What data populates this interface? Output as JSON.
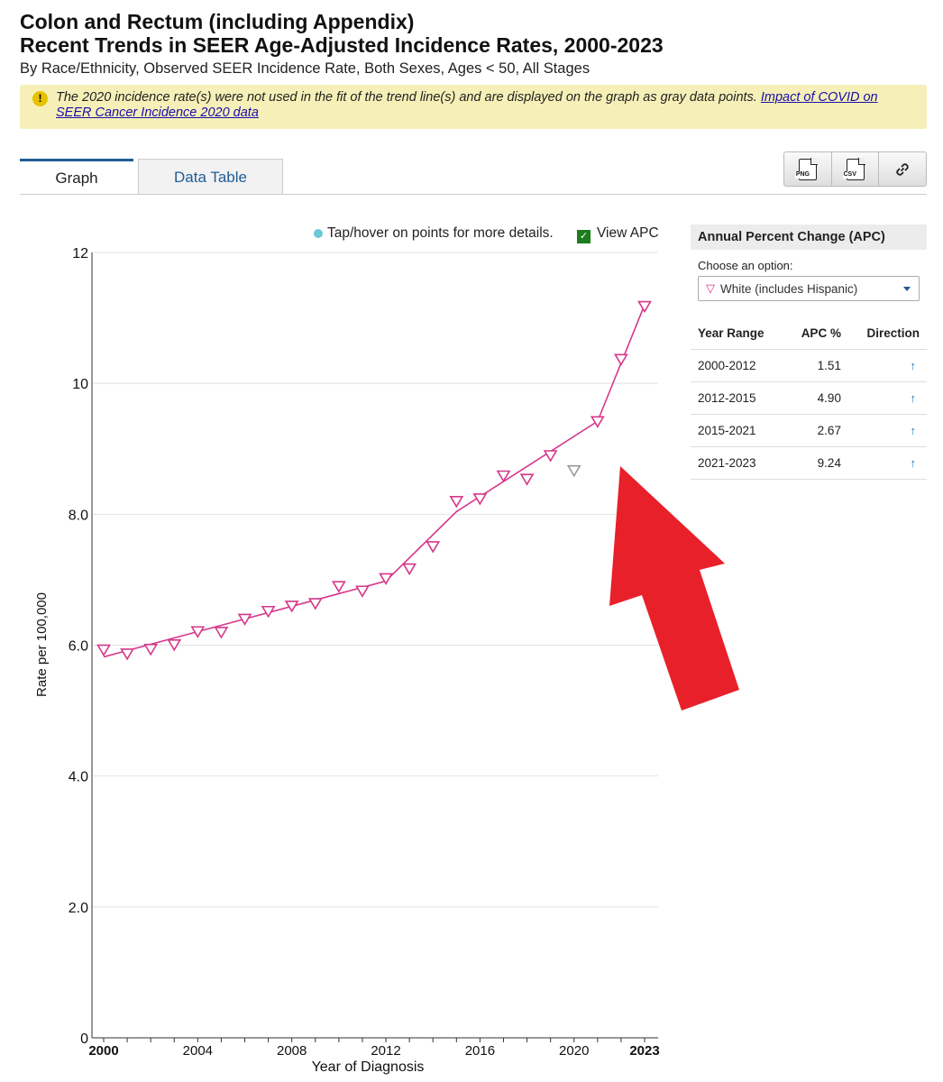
{
  "header": {
    "title_line1": "Colon and Rectum (including Appendix)",
    "title_line2": "Recent Trends in SEER Age-Adjusted Incidence Rates, 2000-2023",
    "subtitle": "By Race/Ethnicity, Observed SEER Incidence Rate, Both Sexes, Ages < 50, All Stages"
  },
  "notice": {
    "text": "The 2020 incidence rate(s) were not used in the fit of the trend line(s) and are displayed on the graph as gray data points. ",
    "link_text": "Impact of COVID on SEER Cancer Incidence 2020 data"
  },
  "tabs": {
    "graph": "Graph",
    "data_table": "Data Table"
  },
  "tools": {
    "png": "PNG",
    "csv": "CSV"
  },
  "hint": "Tap/hover on points for more details.",
  "apc_toggle_label": "View APC",
  "apc_panel": {
    "title": "Annual Percent Change (APC)",
    "choose_label": "Choose an option:",
    "selected": "White (includes Hispanic)",
    "columns": [
      "Year Range",
      "APC %",
      "Direction"
    ],
    "rows": [
      {
        "range": "2000-2012",
        "apc": "1.51",
        "direction": "↑"
      },
      {
        "range": "2012-2015",
        "apc": "4.90",
        "direction": "↑"
      },
      {
        "range": "2015-2021",
        "apc": "2.67",
        "direction": "↑"
      },
      {
        "range": "2021-2023",
        "apc": "9.24",
        "direction": "↑"
      }
    ]
  },
  "colors": {
    "series": "#d6378a",
    "excluded": "#999999",
    "annotation_arrow": "#e8202a"
  },
  "chart_data": {
    "type": "line",
    "xlabel": "Year of Diagnosis",
    "ylabel": "Rate per 100,000",
    "xlim": [
      2000,
      2023
    ],
    "ylim": [
      0,
      12
    ],
    "x_ticks": [
      {
        "value": 2000,
        "label": "2000",
        "bold": true
      },
      {
        "value": 2004,
        "label": "2004"
      },
      {
        "value": 2008,
        "label": "2008"
      },
      {
        "value": 2012,
        "label": "2012"
      },
      {
        "value": 2016,
        "label": "2016"
      },
      {
        "value": 2020,
        "label": "2020"
      },
      {
        "value": 2023,
        "label": "2023",
        "bold": true
      }
    ],
    "y_ticks": [
      {
        "value": 0,
        "label": "0"
      },
      {
        "value": 2,
        "label": "2.0"
      },
      {
        "value": 4,
        "label": "4.0"
      },
      {
        "value": 6,
        "label": "6.0"
      },
      {
        "value": 8,
        "label": "8.0"
      },
      {
        "value": 10,
        "label": "10"
      },
      {
        "value": 12,
        "label": "12"
      }
    ],
    "grid": true,
    "series": [
      {
        "name": "White (includes Hispanic)",
        "marker": "triangle-down",
        "x": [
          2000,
          2001,
          2002,
          2003,
          2004,
          2005,
          2006,
          2007,
          2008,
          2009,
          2010,
          2011,
          2012,
          2013,
          2014,
          2015,
          2016,
          2017,
          2018,
          2019,
          2020,
          2021,
          2022,
          2023
        ],
        "observed": [
          5.93,
          5.87,
          5.94,
          6.01,
          6.21,
          6.2,
          6.4,
          6.52,
          6.6,
          6.64,
          6.9,
          6.83,
          7.02,
          7.17,
          7.51,
          8.2,
          8.24,
          8.59,
          8.54,
          8.9,
          8.67,
          9.42,
          10.37,
          11.18
        ],
        "excluded_years": [
          2020
        ],
        "trend": [
          {
            "x": 2000,
            "y": 5.82
          },
          {
            "x": 2012,
            "y": 6.98
          },
          {
            "x": 2015,
            "y": 8.04
          },
          {
            "x": 2021,
            "y": 9.42
          },
          {
            "x": 2023,
            "y": 11.2
          }
        ]
      }
    ]
  }
}
